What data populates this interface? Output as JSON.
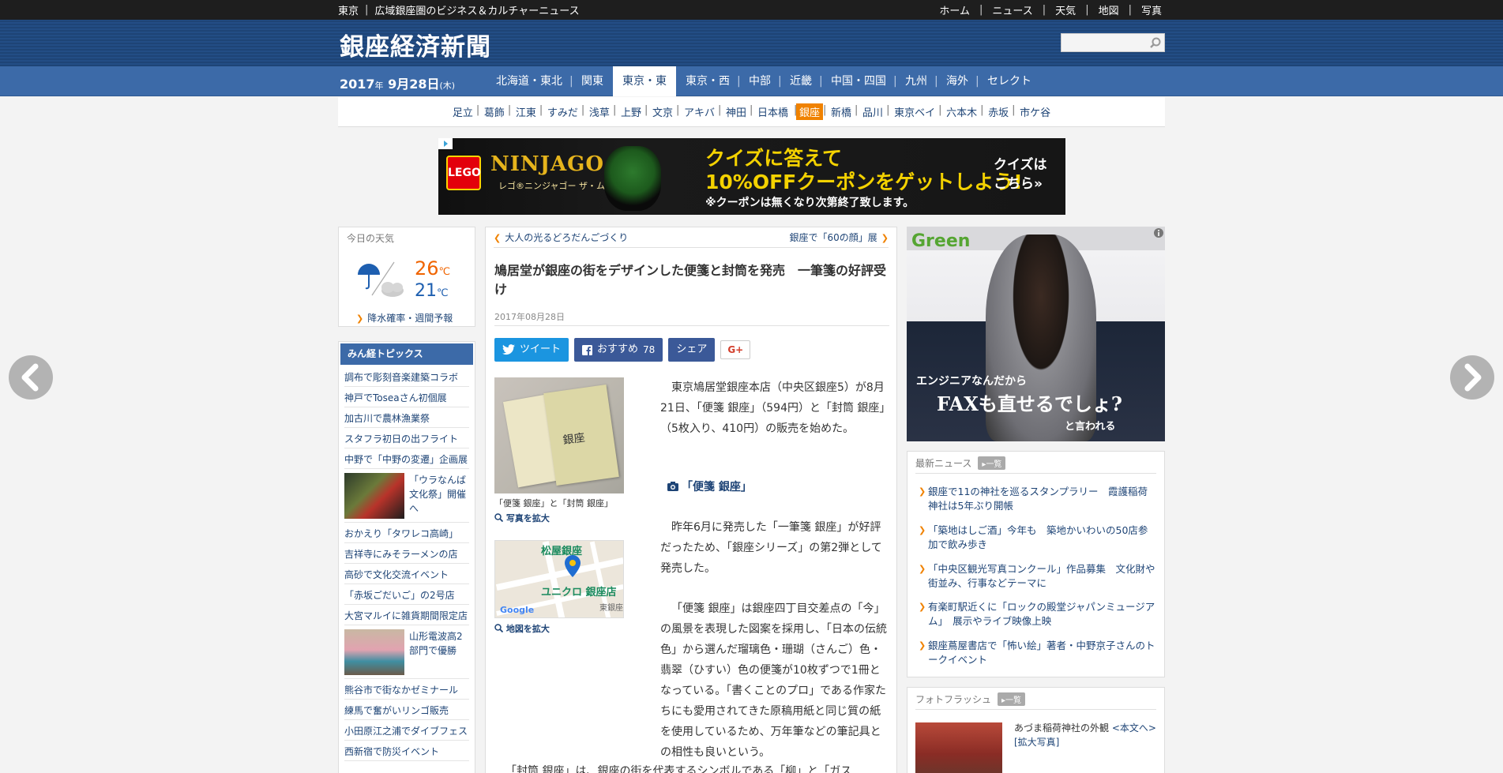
{
  "topbar": {
    "region": "東京",
    "tagline": "広域銀座圏のビジネス＆カルチャーニュース",
    "links": [
      "ホーム",
      "ニュース",
      "天気",
      "地図",
      "写真"
    ]
  },
  "masthead": {
    "logo": "銀座経済新聞",
    "search_placeholder": ""
  },
  "date": {
    "year": "2017",
    "year_unit": "年",
    "date": "9月28日",
    "weekday": "(木)"
  },
  "main_nav": [
    "北海道・東北",
    "関東",
    "東京・東",
    "東京・西",
    "中部",
    "近畿",
    "中国・四国",
    "九州",
    "海外",
    "セレクト"
  ],
  "sub_nav": [
    "足立",
    "葛飾",
    "江東",
    "すみだ",
    "浅草",
    "上野",
    "文京",
    "アキバ",
    "神田",
    "日本橋",
    "銀座",
    "新橋",
    "品川",
    "東京ベイ",
    "六本木",
    "赤坂",
    "市ケ谷"
  ],
  "banner": {
    "brand": "LEGO",
    "title": "NINJAGO",
    "subtitle": "レゴ®ニンジャゴー ザ・ムービー",
    "headline1": "クイズに答えて",
    "headline2": "10%OFFクーポンをゲットしよう!",
    "note": "※クーポンは無くなり次第終了致します。",
    "cta1": "クイズは",
    "cta2": "こちら»"
  },
  "weather": {
    "title": "今日の天気",
    "high": "26",
    "low": "21",
    "unit": "℃",
    "rain_link": "降水確率・週間予報"
  },
  "topics": {
    "title": "みん経トピックス",
    "items_a": [
      "調布で彫刻音楽建築コラボ",
      "神戸でToseaさん初個展",
      "加古川で農林漁業祭",
      "スタフラ初日の出フライト",
      "中野で「中野の変遷」企画展"
    ],
    "thumb1": "「ウラなんば文化祭」開催へ",
    "items_b": [
      "おかえり「タワレコ高崎」",
      "吉祥寺にみそラーメンの店",
      "高砂で文化交流イベント",
      "「赤坂ごだいご」の2号店",
      "大宮マルイに雑貨期間限定店"
    ],
    "thumb2": "山形電波高2部門で優勝",
    "items_c": [
      "熊谷市で街なかゼミナール",
      "練馬で奮がいリンゴ販売",
      "小田原江之浦でダイブフェス",
      "西新宿で防災イベント"
    ]
  },
  "article": {
    "prev": "大人の光るどろだんごづくり",
    "next": "銀座で「60の顔」展",
    "title": "鳩居堂が銀座の街をデザインした便箋と封筒を発売　一筆箋の好評受け",
    "date": "2017年08月28日",
    "share": {
      "tweet": "ツイート",
      "recommend": "おすすめ",
      "recommend_count": "78",
      "share": "シェア",
      "gplus": "G+"
    },
    "photo_text": "銀座",
    "photo_caption": "「便箋 銀座」と「封筒 銀座」",
    "photo_zoom": "写真を拡大",
    "map_label1": "松屋銀座",
    "map_label2": "ユニクロ 銀座店",
    "map_label3": "東銀座",
    "map_google": "Google",
    "map_zoom": "地図を拡大",
    "para1": "東京鳩居堂銀座本店（中央区銀座5）が8月21日、「便箋 銀座」（594円）と「封筒 銀座」（5枚入り、410円）の販売を始めた。",
    "section": "「便箋 銀座」",
    "para2": "昨年6月に発売した「一筆箋 銀座」が好評だったため、「銀座シリーズ」の第2弾として発売した。",
    "para3": "「便箋 銀座」は銀座四丁目交差点の「今」の風景を表現した図案を採用し、「日本の伝統色」から選んだ瑠璃色・珊瑚（さんご）色・翡翠（ひすい）色の便箋が10枚ずつで1冊となっている。「書くことのプロ」である作家たちにも愛用されてきた原稿用紙と同じ質の紙を使用しているため、万年筆などの筆記具との相性も良いという。",
    "para4": "「封筒 銀座」は、銀座の街を代表するシンボルである「柳」と「ガス"
  },
  "ad_right": {
    "brand": "Green",
    "line1": "エンジニアなんだから",
    "line2": "FAXも直せるでしょ?",
    "line3": "と言われる"
  },
  "news": {
    "title": "最新ニュース",
    "more": "一覧",
    "items": [
      "銀座で11の神社を巡るスタンプラリー　霞護稲荷神社は5年ぶり開帳",
      "「築地はしご酒」今年も　築地かいわいの50店参加で飲み歩き",
      "「中央区観光写真コンクール」作品募集　文化財や街並み、行事などテーマに",
      "有楽町駅近くに「ロックの殿堂ジャパンミュージアム」　展示やライブ映像上映",
      "銀座蔦屋書店で「怖い絵」著者・中野京子さんのトークイベント"
    ]
  },
  "photoflash": {
    "title": "フォトフラッシュ",
    "more": "一覧",
    "caption": "あづま稲荷神社の外観",
    "link1": "<本文へ>",
    "link2": "[拡大写真]"
  }
}
